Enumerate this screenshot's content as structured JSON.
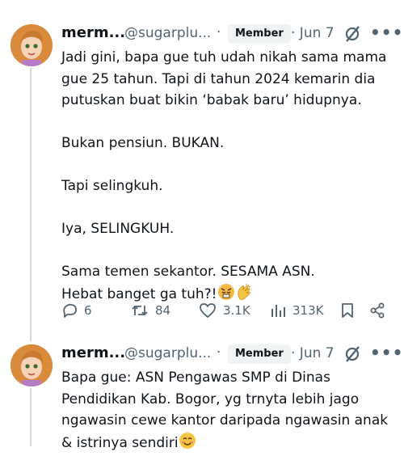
{
  "tweets": [
    {
      "name": "merm...",
      "handle": "@sugarplu...",
      "dot": "·",
      "badge": "Member",
      "date": "· Jun 7",
      "more": "•••",
      "lines": [
        "Jadi gini, bapa gue tuh udah nikah sama mama",
        "gue 25 tahun. Tapi di tahun 2024 kemarin dia",
        "putuskan buat bikin ‘babak baru’ hidupnya.",
        "",
        "Bukan pensiun. BUKAN.",
        "",
        "Tapi selingkuh.",
        "",
        "Iya, SELINGKUH.",
        "",
        "Sama temen sekantor. SESAMA ASN.",
        "Hebat banget ga tuh?!"
      ],
      "emojis": [
        "angry-face-emoji",
        "clapping-hands-emoji"
      ],
      "actions": {
        "replies": "6",
        "reposts": "84",
        "likes": "3.1K",
        "views": "313K"
      }
    },
    {
      "name": "merm...",
      "handle": "@sugarplu...",
      "dot": "·",
      "badge": "Member",
      "date": "· Jun 7",
      "more": "•••",
      "lines": [
        "Bapa gue: ASN Pengawas SMP di Dinas",
        "Pendidikan Kab. Bogor, yg trnyta lebih jago",
        "ngawasin cewe kantor daripada ngawasin anak",
        "& istrinya sendiri"
      ],
      "emojis": [
        "smiling-face-emoji"
      ]
    }
  ],
  "colors": {
    "muted": "#536471",
    "thread": "#cfd9de",
    "badge_bg": "#eff3f4"
  }
}
